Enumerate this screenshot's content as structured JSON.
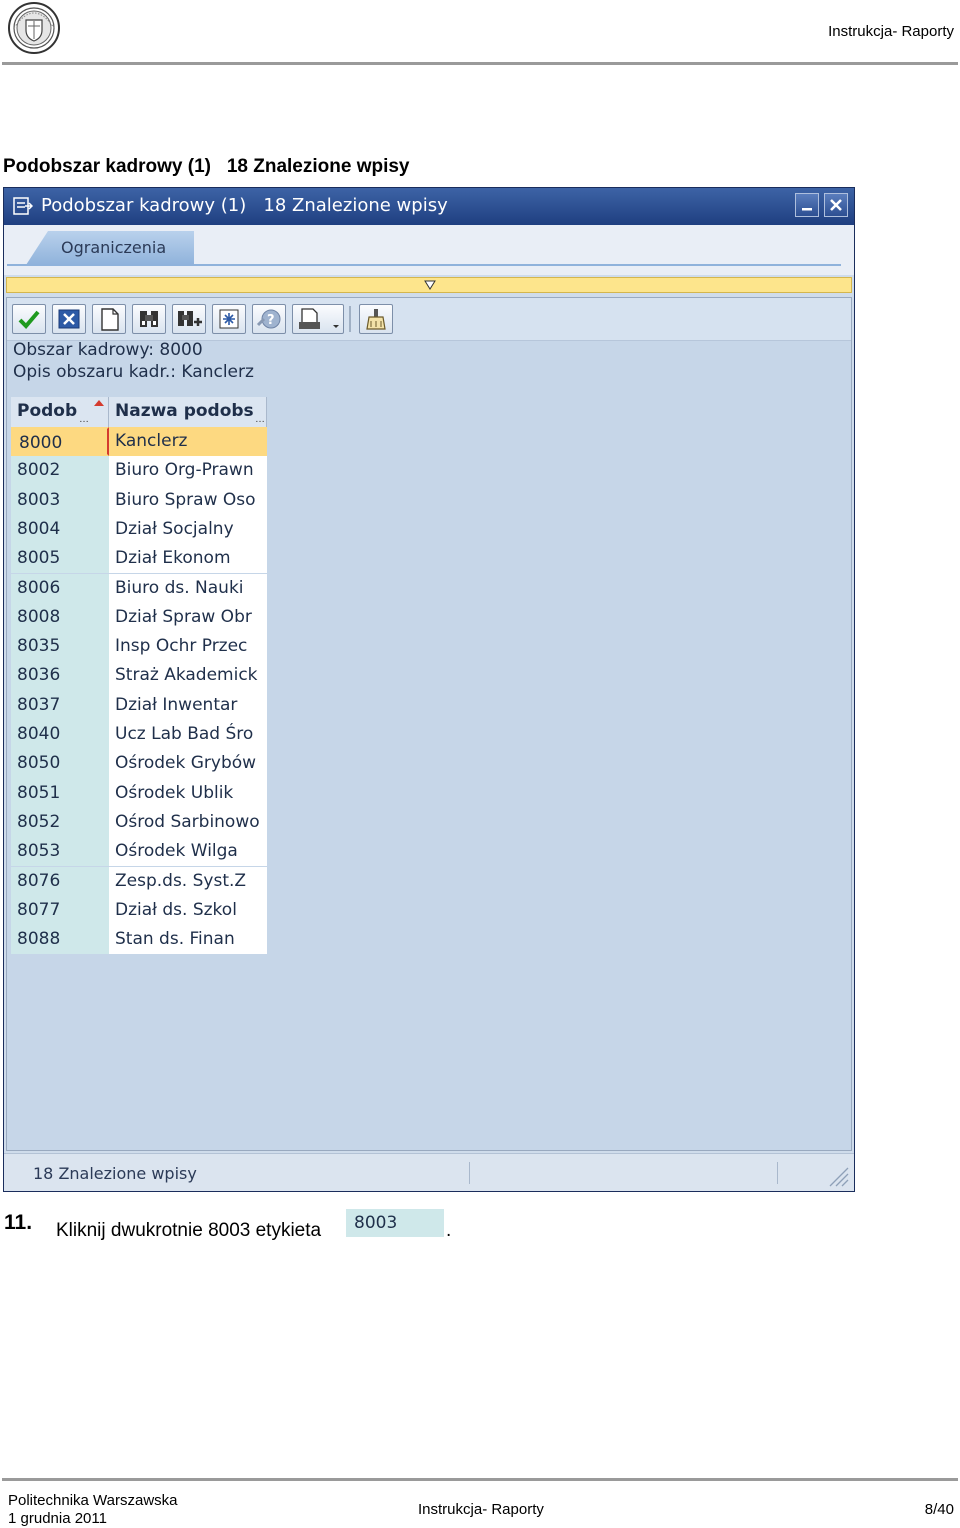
{
  "page_header": {
    "right_title": "Instrukcja- Raporty"
  },
  "caption": "Podobszar kadrowy (1)   18 Znalezione wpisy",
  "dialog": {
    "title": "Podobszar kadrowy (1)   18 Znalezione wpisy",
    "tab": "Ograniczenia",
    "info_line1": "Obszar kadrowy: 8000",
    "info_line2": "Opis obszaru kadr.: Kanclerz",
    "columns": {
      "code": "Podob",
      "name": "Nazwa podobs"
    },
    "rows": [
      {
        "code": "8000",
        "name": "Kanclerz"
      },
      {
        "code": "8002",
        "name": "Biuro Org-Prawn"
      },
      {
        "code": "8003",
        "name": "Biuro Spraw Oso"
      },
      {
        "code": "8004",
        "name": "Dział Socjalny"
      },
      {
        "code": "8005",
        "name": "Dział Ekonom"
      },
      {
        "code": "8006",
        "name": "Biuro ds. Nauki"
      },
      {
        "code": "8008",
        "name": "Dział Spraw Obr"
      },
      {
        "code": "8035",
        "name": "Insp Ochr Przec"
      },
      {
        "code": "8036",
        "name": "Straż Akademick"
      },
      {
        "code": "8037",
        "name": "Dział Inwentar"
      },
      {
        "code": "8040",
        "name": "Ucz Lab Bad Śro"
      },
      {
        "code": "8050",
        "name": "Ośrodek Grybów"
      },
      {
        "code": "8051",
        "name": "Ośrodek Ublik"
      },
      {
        "code": "8052",
        "name": "Ośrod Sarbinowo"
      },
      {
        "code": "8053",
        "name": "Ośrodek Wilga"
      },
      {
        "code": "8076",
        "name": "Zesp.ds. Syst.Z"
      },
      {
        "code": "8077",
        "name": "Dział ds. Szkol"
      },
      {
        "code": "8088",
        "name": "Stan ds. Finan"
      }
    ],
    "status": "18 Znalezione wpisy",
    "toolbar_icons": [
      "checkmark-icon",
      "cancel-icon",
      "new-document-icon",
      "find-icon",
      "find-next-icon",
      "sort-icon",
      "help-icon",
      "print-icon",
      "clear-icon"
    ]
  },
  "instruction": {
    "number": "11.",
    "text": "Kliknij dwukrotnie 8003 etykieta",
    "chip": "8003",
    "end": "."
  },
  "footer": {
    "org": "Politechnika Warszawska",
    "date": "1 grudnia 2011",
    "title": "Instrukcja- Raporty",
    "page": "8/40"
  },
  "colors": {
    "titlebar": "#2a4b8d",
    "code_cell": "#cfe8ea",
    "selected_row": "#fdd981",
    "panel": "#c6d6e8"
  }
}
